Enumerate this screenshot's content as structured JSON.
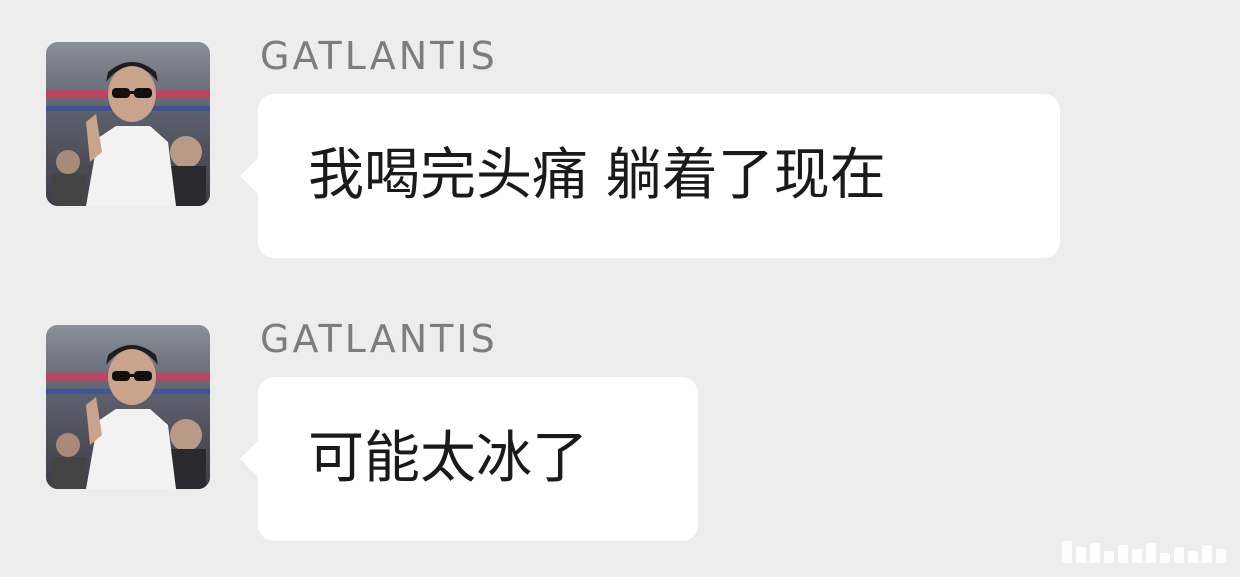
{
  "messages": [
    {
      "sender": "GATLANTIS",
      "text": "我喝完头痛 躺着了现在",
      "avatar_icon": "person-photo-avatar"
    },
    {
      "sender": "GATLANTIS",
      "text": "可能太冰了",
      "avatar_icon": "person-photo-avatar"
    }
  ],
  "colors": {
    "background": "#ededed",
    "bubble": "#ffffff",
    "sender_text": "#7d7d7d",
    "message_text": "#1a1a1a"
  }
}
